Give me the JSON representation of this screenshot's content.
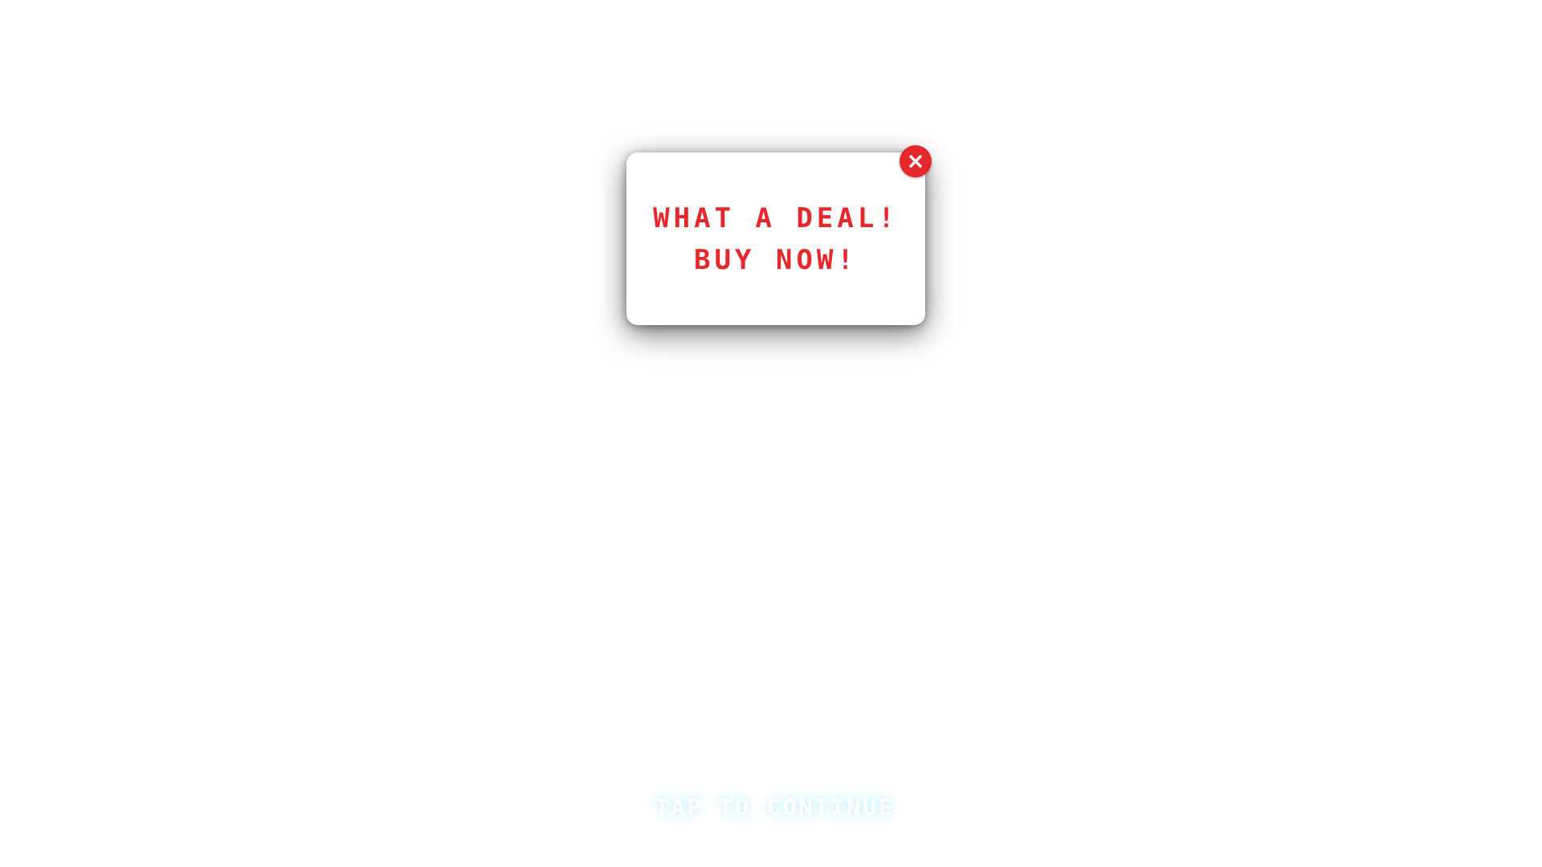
{
  "popup": {
    "line1": "WHAT A DEAL!",
    "line2": "BUY NOW!",
    "close_icon": "close-icon",
    "accent_color": "#e5282c"
  },
  "footer": {
    "tap_label": "TAP TO CONTINUE",
    "glow_color": "#c8eefc"
  }
}
